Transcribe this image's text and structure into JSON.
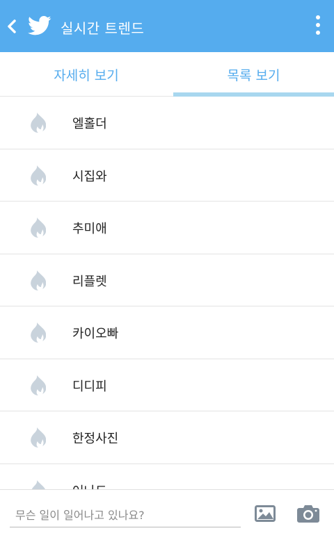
{
  "header": {
    "title": "실시간 트렌드",
    "back_icon": "chevron-left-icon",
    "logo_icon": "twitter-bird-icon",
    "menu_icon": "more-vertical-icon",
    "background_color": "#55acee"
  },
  "tabs": [
    {
      "label": "자세히 보기",
      "selected": false
    },
    {
      "label": "목록 보기",
      "selected": true
    }
  ],
  "trends": [
    {
      "label": "엘홀더",
      "icon": "flame-icon"
    },
    {
      "label": "시집와",
      "icon": "flame-icon"
    },
    {
      "label": "추미애",
      "icon": "flame-icon"
    },
    {
      "label": "리플렛",
      "icon": "flame-icon"
    },
    {
      "label": "카이오빠",
      "icon": "flame-icon"
    },
    {
      "label": "디디피",
      "icon": "flame-icon"
    },
    {
      "label": "한정사진",
      "icon": "flame-icon"
    },
    {
      "label": "어나드",
      "icon": "flame-icon"
    }
  ],
  "composer": {
    "placeholder": "무슨 일이 일어나고 있나요?",
    "image_icon": "image-icon",
    "camera_icon": "camera-icon"
  },
  "colors": {
    "accent": "#55acee",
    "tab_indicator": "#a8d7ef",
    "flame": "#c9d3dc"
  }
}
